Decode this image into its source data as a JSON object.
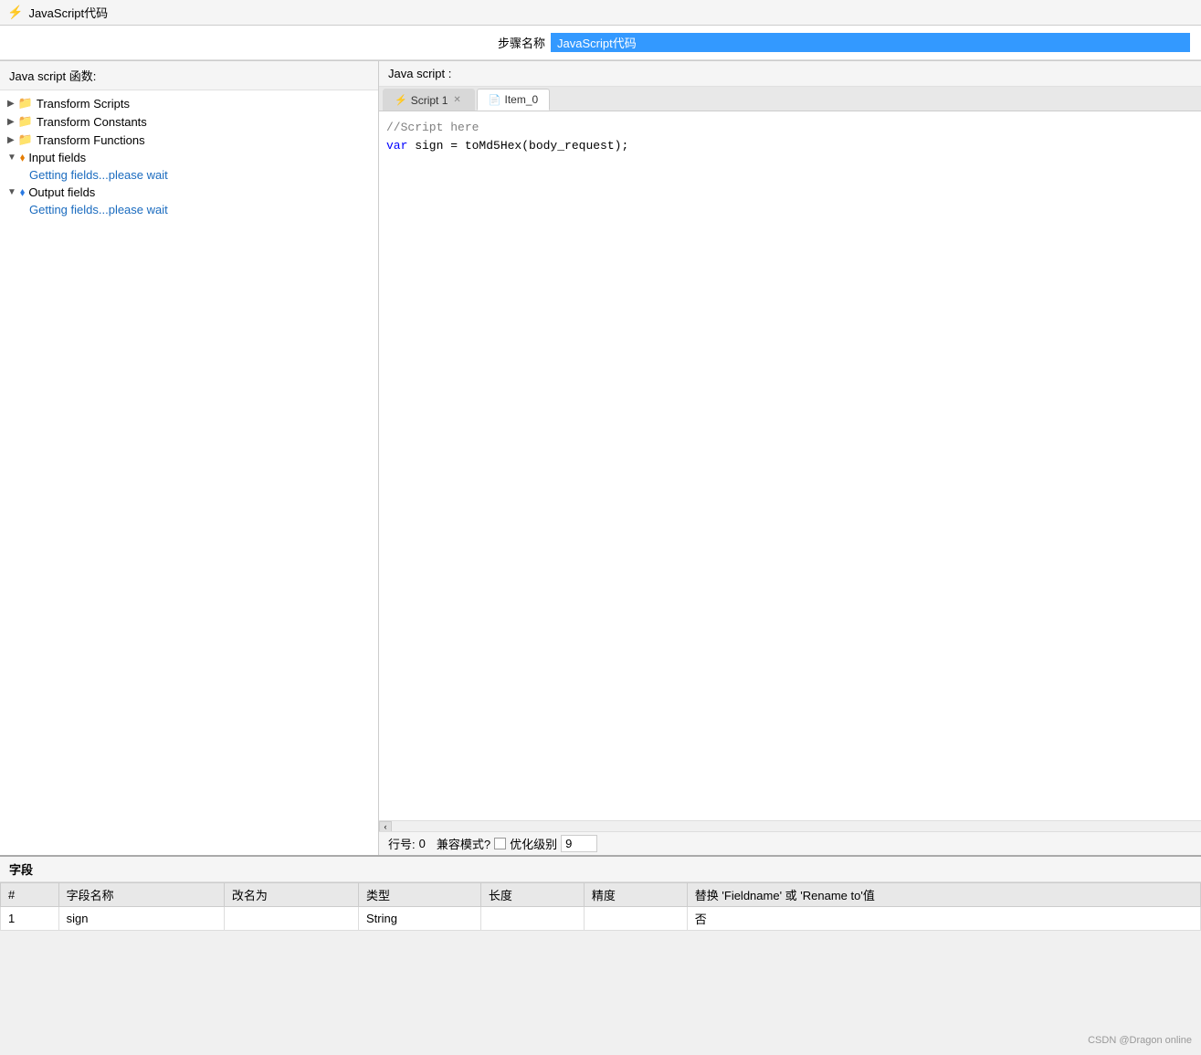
{
  "titleBar": {
    "icon": "⚡",
    "title": "JavaScript代码"
  },
  "stepName": {
    "label": "步骤名称",
    "value": "JavaScript代码"
  },
  "leftPanel": {
    "header": "Java script 函数:",
    "treeItems": [
      {
        "id": "transform-scripts",
        "arrow": "▶",
        "icon": "folder",
        "label": "Transform Scripts",
        "indent": 0
      },
      {
        "id": "transform-constants",
        "arrow": "▶",
        "icon": "folder",
        "label": "Transform Constants",
        "indent": 0
      },
      {
        "id": "transform-functions",
        "arrow": "▶",
        "icon": "folder",
        "label": "Transform Functions",
        "indent": 0
      },
      {
        "id": "input-fields",
        "arrow": "▼",
        "icon": "input",
        "label": "Input fields",
        "indent": 0
      },
      {
        "id": "input-fields-loading",
        "label": "Getting fields...please wait",
        "indent": 1,
        "isSubItem": true
      },
      {
        "id": "output-fields",
        "arrow": "▼",
        "icon": "output",
        "label": "Output fields",
        "indent": 0
      },
      {
        "id": "output-fields-loading",
        "label": "Getting fields...please wait",
        "indent": 1,
        "isSubItem": true
      }
    ]
  },
  "rightPanel": {
    "header": "Java script :",
    "tabs": [
      {
        "id": "script1",
        "icon": "⚡",
        "label": "Script 1",
        "hasClose": true,
        "active": false
      },
      {
        "id": "item0",
        "icon": "📄",
        "label": "Item_0",
        "hasClose": false,
        "active": true
      }
    ],
    "code": {
      "comment": "//Script here",
      "line1": "var sign = toMd5Hex(body_request);"
    },
    "statusBar": {
      "lineLabel": "行号:",
      "lineValue": "0",
      "compatLabel": "兼容模式?",
      "optimizeLabel": "优化级别",
      "optimizeValue": "9"
    }
  },
  "bottomSection": {
    "header": "字段",
    "columns": [
      "#",
      "字段名称",
      "改名为",
      "类型",
      "长度",
      "精度",
      "替换 'Fieldname' 或 'Rename to'值"
    ],
    "rows": [
      {
        "num": "1",
        "name": "sign",
        "rename": "",
        "type": "String",
        "length": "",
        "precision": "",
        "replace": "否"
      }
    ]
  },
  "watermark": "CSDN @Dragon online"
}
